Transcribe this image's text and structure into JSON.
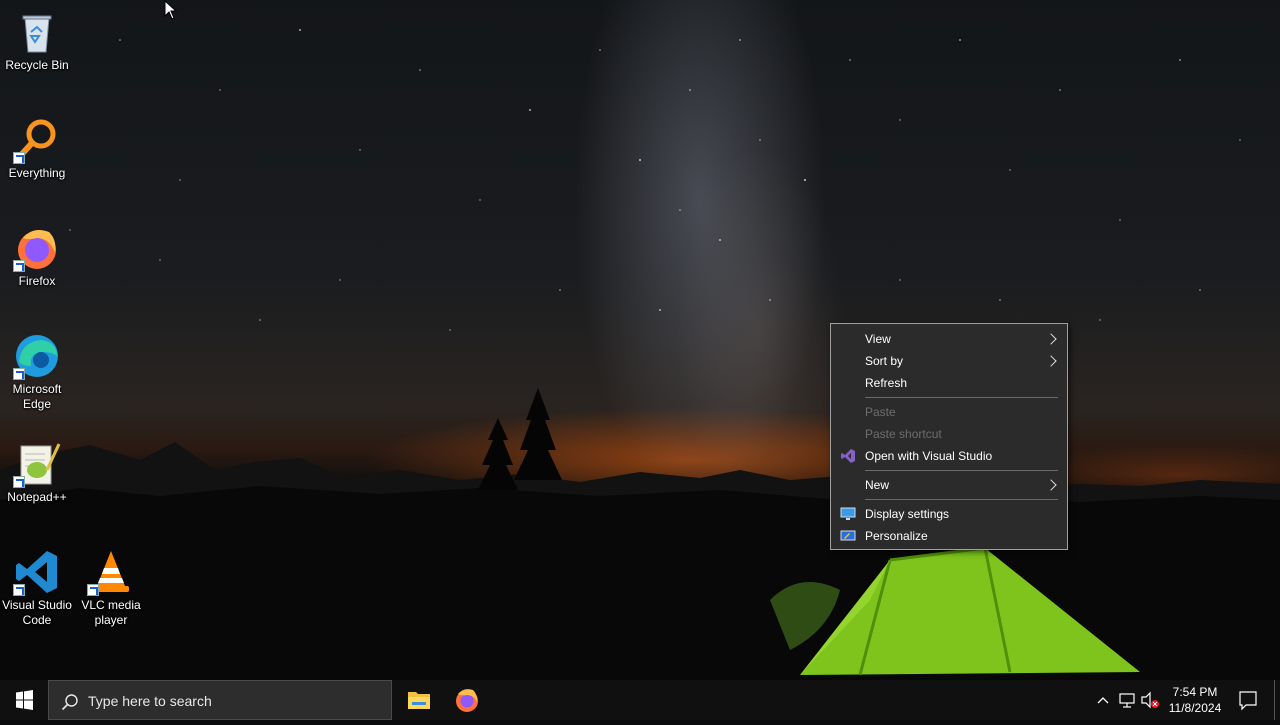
{
  "desktop": {
    "icons": [
      {
        "label": "Recycle Bin",
        "icon": "recycle-bin-icon"
      },
      {
        "label": "Everything",
        "icon": "everything-search-icon"
      },
      {
        "label": "Firefox",
        "icon": "firefox-icon"
      },
      {
        "label": "Microsoft Edge",
        "icon": "edge-icon"
      },
      {
        "label": "Notepad++",
        "icon": "notepad-plus-plus-icon"
      },
      {
        "label": "Visual Studio Code",
        "icon": "vscode-icon"
      },
      {
        "label": "VLC media player",
        "icon": "vlc-icon"
      }
    ]
  },
  "context_menu": {
    "items": [
      {
        "label": "View",
        "submenu": true,
        "enabled": true
      },
      {
        "label": "Sort by",
        "submenu": true,
        "enabled": true
      },
      {
        "label": "Refresh",
        "submenu": false,
        "enabled": true
      },
      {
        "label": "Paste",
        "submenu": false,
        "enabled": false
      },
      {
        "label": "Paste shortcut",
        "submenu": false,
        "enabled": false
      },
      {
        "label": "Open with Visual Studio",
        "submenu": false,
        "enabled": true,
        "icon": "visual-studio-icon"
      },
      {
        "label": "New",
        "submenu": true,
        "enabled": true
      },
      {
        "label": "Display settings",
        "submenu": false,
        "enabled": true,
        "icon": "display-settings-icon"
      },
      {
        "label": "Personalize",
        "submenu": false,
        "enabled": true,
        "icon": "personalize-icon"
      }
    ]
  },
  "taskbar": {
    "search_placeholder": "Type here to search",
    "pinned": [
      "file-explorer-icon",
      "firefox-icon"
    ],
    "tray": [
      "show-hidden-icons-chevron",
      "network-icon",
      "volume-muted-icon",
      "action-center-icon"
    ],
    "clock": {
      "time": "7:54 PM",
      "date": "11/8/2024"
    }
  },
  "colors": {
    "menu_bg": "#2b2b2b",
    "taskbar_bg": "#101010",
    "search_bg": "#2d2d2d",
    "windows_blue": "#0078d7"
  }
}
